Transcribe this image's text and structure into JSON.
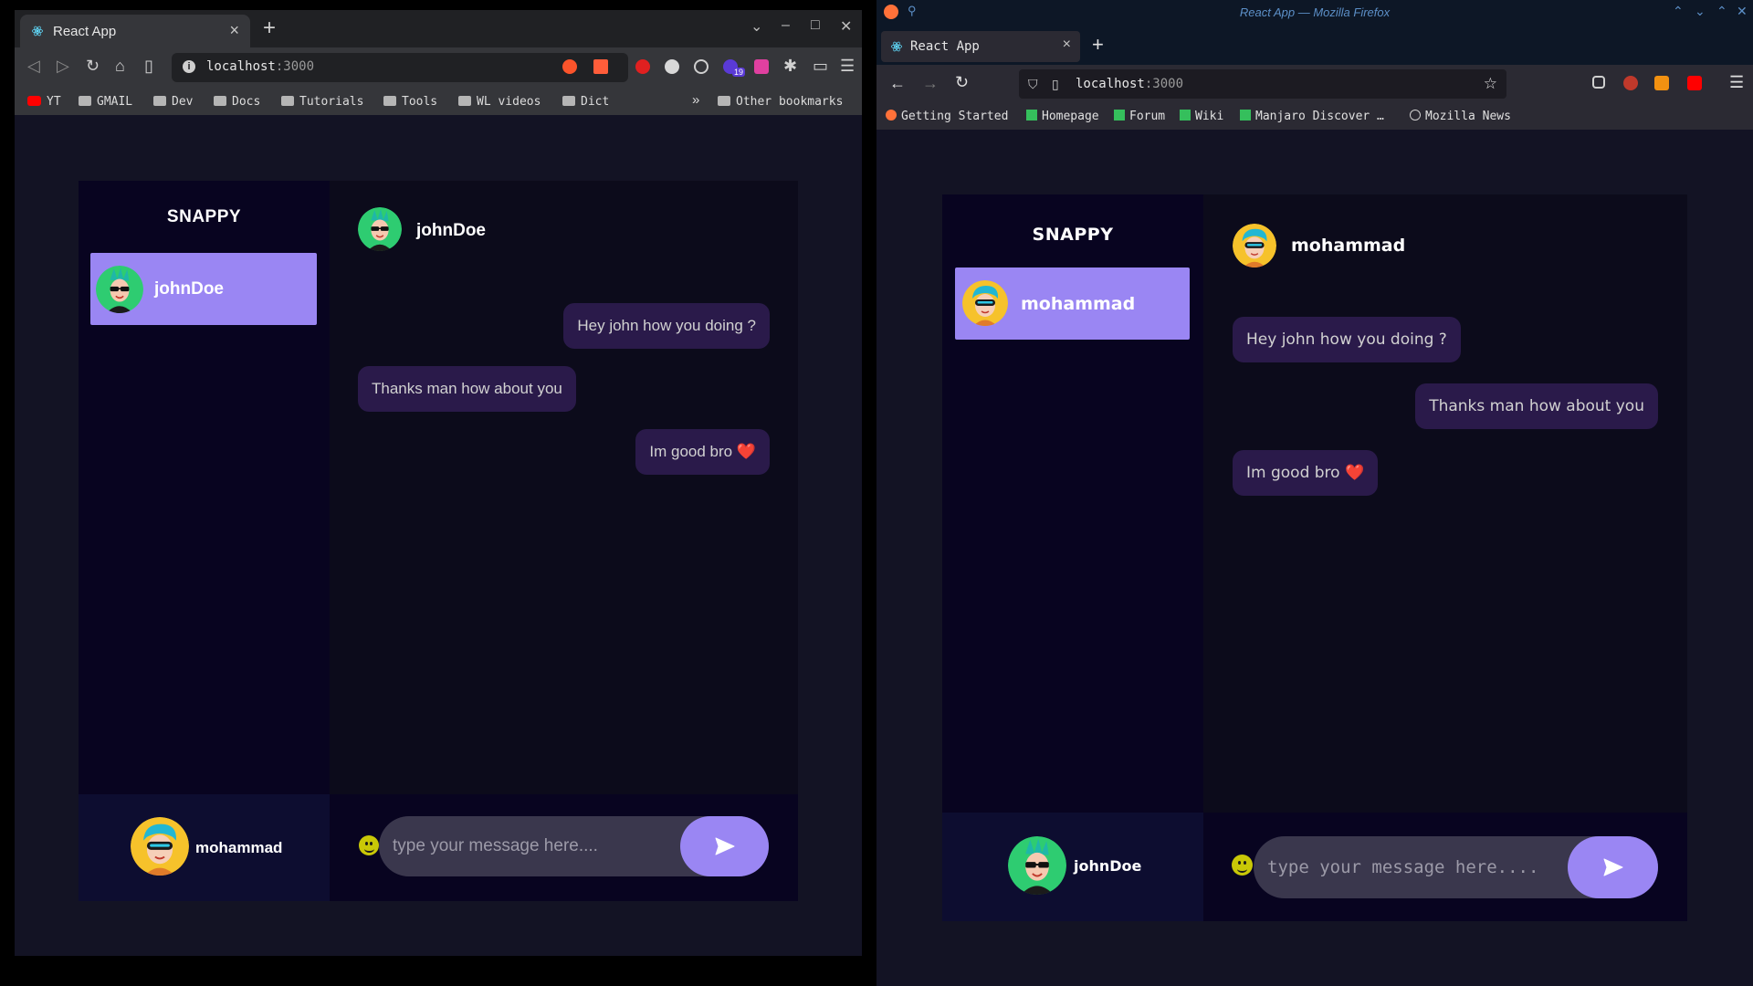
{
  "colors": {
    "accent": "#9a86f3",
    "sidebar_bg": "#080420",
    "page_bg": "#131324",
    "message_bg": "#2a1a4a"
  },
  "left_browser": {
    "tab_title": "React App",
    "url_host": "localhost",
    "url_port": ":3000",
    "extension_badge": "19",
    "bookmarks": [
      "YT",
      "GMAIL",
      "Dev",
      "Docs",
      "Tutorials",
      "Tools",
      "WL videos",
      "Dict"
    ],
    "overflow_label": "»",
    "other_bookmarks": "Other bookmarks"
  },
  "right_browser": {
    "window_title": "React App — Mozilla Firefox",
    "tab_title": "React App",
    "url_host": "localhost",
    "url_port": ":3000",
    "bookmarks": [
      "Getting Started",
      "Homepage",
      "Forum",
      "Wiki",
      "Manjaro Discover …",
      "Mozilla News"
    ]
  },
  "left_chat": {
    "brand": "SNAPPY",
    "contact": {
      "name": "johnDoe",
      "avatar": "green-avatar"
    },
    "current_user": {
      "name": "mohammad",
      "avatar": "yellow-avatar"
    },
    "header": {
      "name": "johnDoe",
      "avatar": "green-avatar"
    },
    "messages": [
      {
        "text": "Hey john how you doing ?",
        "side": "sent"
      },
      {
        "text": "Thanks man how about you",
        "side": "received"
      },
      {
        "text": "Im good bro ❤️",
        "side": "sent"
      }
    ],
    "input": {
      "placeholder": "type your message here....",
      "value": ""
    },
    "emoji_icon": "smiley-icon",
    "send_icon": "send-icon"
  },
  "right_chat": {
    "brand": "SNAPPY",
    "contact": {
      "name": "mohammad",
      "avatar": "yellow-avatar"
    },
    "current_user": {
      "name": "johnDoe",
      "avatar": "green-avatar"
    },
    "header": {
      "name": "mohammad",
      "avatar": "yellow-avatar"
    },
    "messages": [
      {
        "text": "Hey john how you doing ?",
        "side": "received"
      },
      {
        "text": "Thanks man how about you",
        "side": "sent"
      },
      {
        "text": "Im good bro ❤️",
        "side": "received"
      }
    ],
    "input": {
      "placeholder": "type your message here....",
      "value": ""
    },
    "emoji_icon": "smiley-icon",
    "send_icon": "send-icon"
  }
}
